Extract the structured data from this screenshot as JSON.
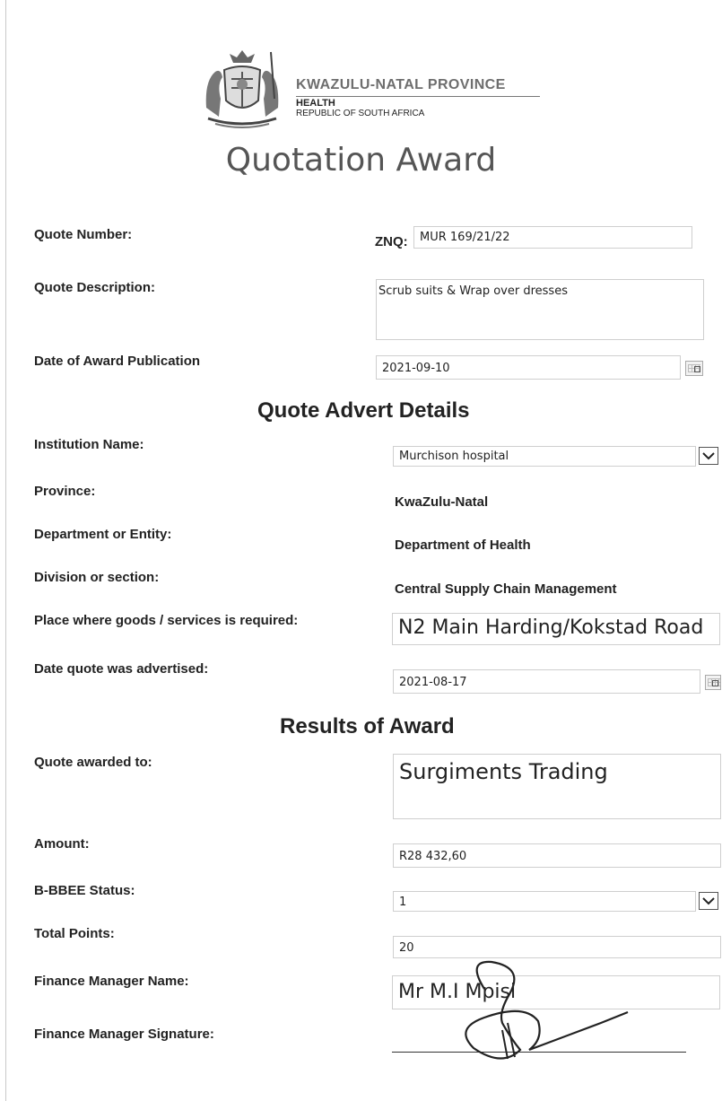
{
  "header": {
    "province": "KWAZULU-NATAL PROVINCE",
    "department": "HEALTH",
    "republic": "REPUBLIC OF SOUTH AFRICA"
  },
  "title": "Quotation Award",
  "quote": {
    "number_label": "Quote Number:",
    "number_prefix": "ZNQ:",
    "number_value": "MUR 169/21/22",
    "description_label": "Quote Description:",
    "description_value": "Scrub suits & Wrap over dresses",
    "publication_label": "Date of Award Publication",
    "publication_value": "2021-09-10"
  },
  "advert": {
    "heading": "Quote Advert Details",
    "institution_label": "Institution Name:",
    "institution_value": "Murchison hospital",
    "province_label": "Province:",
    "province_value": "KwaZulu-Natal",
    "department_label": "Department or Entity:",
    "department_value": "Department of Health",
    "division_label": "Division or section:",
    "division_value": "Central Supply Chain Management",
    "place_label": "Place where goods /  services is required:",
    "place_value": "N2 Main Harding/Kokstad Road",
    "advertised_label": "Date quote was advertised:",
    "advertised_value": "2021-08-17"
  },
  "results": {
    "heading": "Results of Award",
    "awarded_label": "Quote awarded to:",
    "awarded_value": "Surgiments Trading",
    "amount_label": "Amount:",
    "amount_value": "R28 432,60",
    "bbbee_label": "B-BBEE Status:",
    "bbbee_value": "1",
    "points_label": "Total Points:",
    "points_value": "20",
    "fm_name_label": "Finance Manager Name:",
    "fm_name_value": "Mr M.I Mpisi",
    "fm_signature_label": "Finance Manager Signature:"
  }
}
